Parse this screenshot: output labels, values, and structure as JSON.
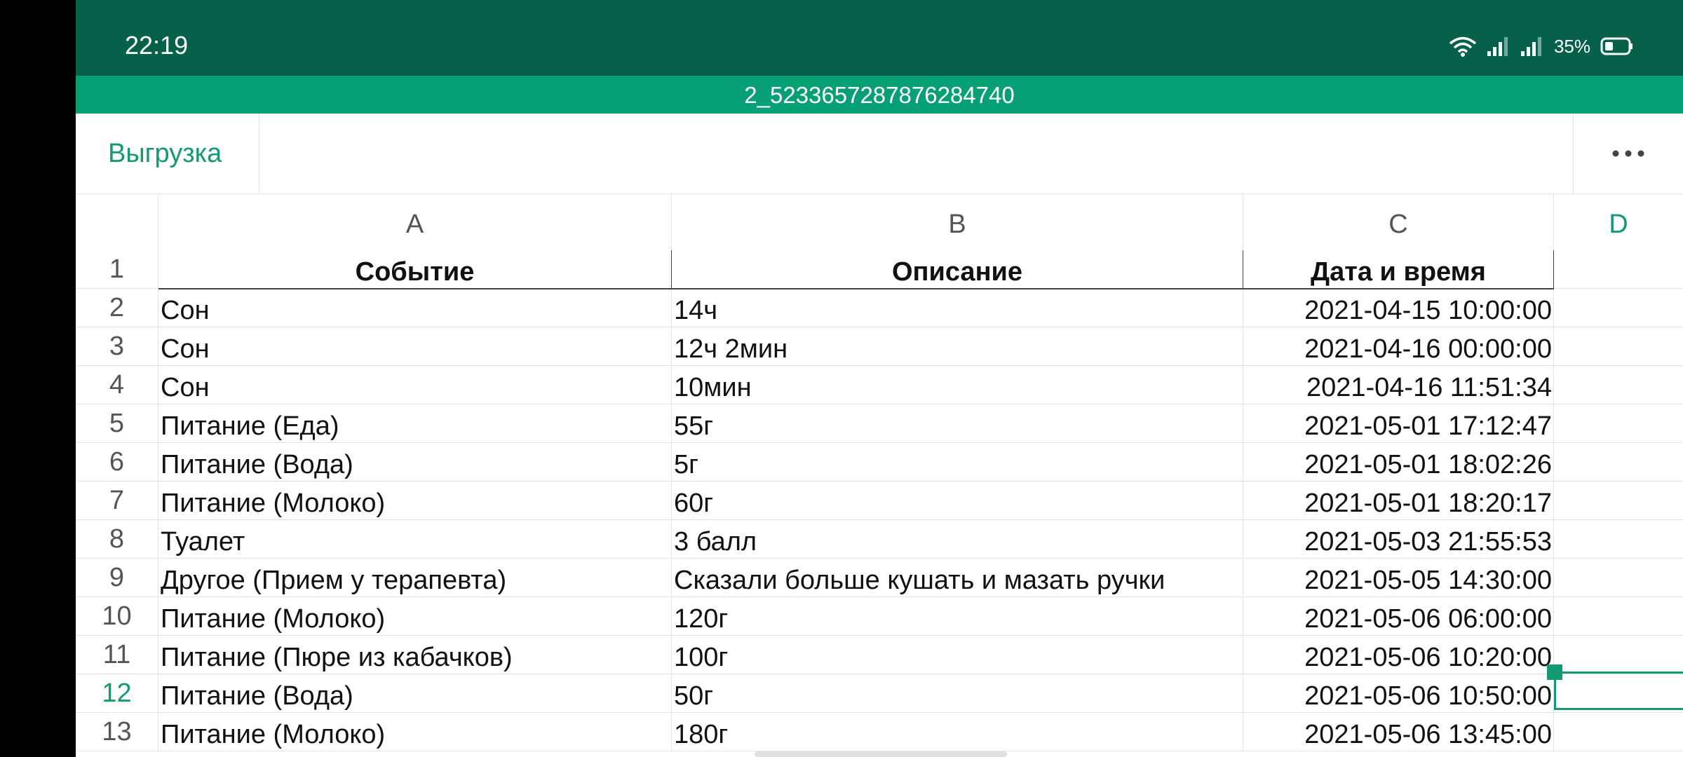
{
  "status_bar": {
    "time": "22:19",
    "battery_percent": "35%",
    "icons": [
      "wifi-icon",
      "signal-icon",
      "signal-icon",
      "battery-icon"
    ]
  },
  "title_bar": {
    "title": "2_5233657287876284740"
  },
  "toolbar": {
    "export_label": "Выгрузка",
    "more_icon": "more-horizontal-icon"
  },
  "columns": [
    "A",
    "B",
    "C",
    "D"
  ],
  "active_column": "D",
  "active_row": "12",
  "colors": {
    "status_bar": "#07604a",
    "title_bar": "#07a075",
    "accent": "#139a74"
  },
  "table": {
    "header": {
      "row_number": "1",
      "cells": [
        "Событие",
        "Описание",
        "Дата и время"
      ]
    },
    "rows": [
      {
        "num": "2",
        "cells": [
          "Сон",
          "14ч",
          "2021-04-15 10:00:00"
        ]
      },
      {
        "num": "3",
        "cells": [
          "Сон",
          "12ч 2мин",
          "2021-04-16 00:00:00"
        ]
      },
      {
        "num": "4",
        "cells": [
          "Сон",
          "10мин",
          "2021-04-16 11:51:34"
        ]
      },
      {
        "num": "5",
        "cells": [
          "Питание (Еда)",
          "55г",
          "2021-05-01 17:12:47"
        ]
      },
      {
        "num": "6",
        "cells": [
          "Питание (Вода)",
          "5г",
          "2021-05-01 18:02:26"
        ]
      },
      {
        "num": "7",
        "cells": [
          "Питание (Молоко)",
          "60г",
          "2021-05-01 18:20:17"
        ]
      },
      {
        "num": "8",
        "cells": [
          "Туалет",
          "3 балл",
          "2021-05-03 21:55:53"
        ]
      },
      {
        "num": "9",
        "cells": [
          "Другое (Прием у терапевта)",
          "Сказали больше кушать и мазать ручки",
          "2021-05-05 14:30:00"
        ]
      },
      {
        "num": "10",
        "cells": [
          "Питание (Молоко)",
          "120г",
          "2021-05-06 06:00:00"
        ]
      },
      {
        "num": "11",
        "cells": [
          "Питание (Пюре из кабачков)",
          "100г",
          "2021-05-06 10:20:00"
        ]
      },
      {
        "num": "12",
        "cells": [
          "Питание (Вода)",
          "50г",
          "2021-05-06 10:50:00"
        ]
      },
      {
        "num": "13",
        "cells": [
          "Питание (Молоко)",
          "180г",
          "2021-05-06 13:45:00"
        ]
      }
    ]
  }
}
